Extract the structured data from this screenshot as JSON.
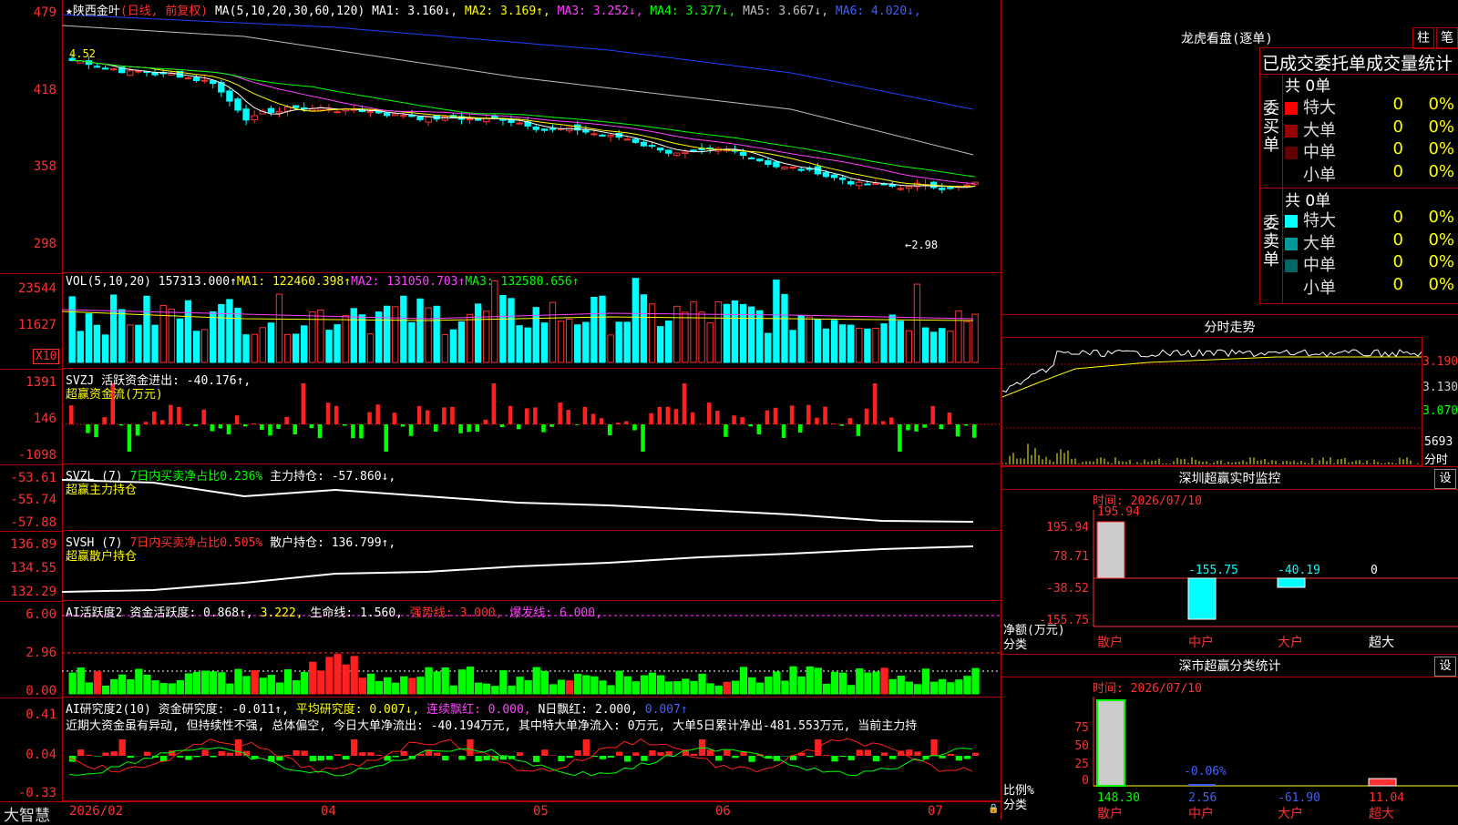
{
  "main": {
    "stock_name": "★陕西金叶",
    "period": "(日线, 前复权)",
    "ma_header": "MA(5,10,20,30,60,120)",
    "ma": [
      {
        "label": "MA1:",
        "value": "3.160↓",
        "color": "#ffffff"
      },
      {
        "label": "MA2:",
        "value": "3.169↑",
        "color": "#ffff00"
      },
      {
        "label": "MA3:",
        "value": "3.252↓",
        "color": "#ff40ff"
      },
      {
        "label": "MA4:",
        "value": "3.377↓",
        "color": "#00ff00"
      },
      {
        "label": "MA5:",
        "value": "3.667↓",
        "color": "#c0c0c0"
      },
      {
        "label": "MA6:",
        "value": "4.020↓",
        "color": "#4060ff"
      }
    ],
    "y_ticks": [
      "479",
      "418",
      "358",
      "298"
    ],
    "high_label": "4.52",
    "low_label": "←2.98"
  },
  "vol": {
    "header": "VOL(5,10,20)",
    "value": "157313.000↑",
    "ma1": "MA1: 122460.398↑",
    "ma2": "MA2: 131050.703↑",
    "ma3": "MA3: 132580.656↑",
    "y_ticks": [
      "23544",
      "11627"
    ],
    "unit": "X10"
  },
  "svzj": {
    "header": "SVZJ  活跃资金进出: -40.176↑,",
    "subtitle": "超赢资金流(万元)",
    "y_ticks": [
      "1391",
      "146",
      "-1098"
    ]
  },
  "svzl": {
    "header": "SVZL (7)",
    "ratio": "7日内买卖净占比0.236%",
    "hold": "主力持仓: -57.860↓,",
    "subtitle": "超赢主力持仓",
    "y_ticks": [
      "-53.61",
      "-55.74",
      "-57.88"
    ]
  },
  "svsh": {
    "header": "SVSH (7)",
    "ratio": "7日内买卖净占比0.505%",
    "hold": "散户持仓: 136.799↑,",
    "subtitle": "超赢散户持仓",
    "y_ticks": [
      "136.89",
      "134.55",
      "132.29"
    ]
  },
  "ai1": {
    "header": "AI活跃度2",
    "a": "资金活跃度: 0.868↑,",
    "b": "3.222,",
    "c": "生命线: 1.560,",
    "d": "强势线: 3.000,",
    "e": "爆发线: 6.000,",
    "y_ticks": [
      "6.00",
      "2.96",
      "0.00"
    ]
  },
  "ai2": {
    "header": "AI研究度2(10)",
    "a": "资金研究度: -0.011↑,",
    "b": "平均研究度: 0.007↓,",
    "c": "连续飘红: 0.000,",
    "d": "N日飘红: 2.000,",
    "e": "0.007↑",
    "text": "近期大资金虽有异动, 但持续性不强, 总体偏空, 今日大单净流出: -40.194万元, 其中特大单净流入: 0万元, 大单5日累计净出-481.553万元, 当前主力持",
    "y_ticks": [
      "0.41",
      "0.04",
      "-0.33"
    ]
  },
  "xaxis": {
    "brand": "大智慧",
    "labels": [
      "2026/02",
      "04",
      "05",
      "06",
      "07"
    ]
  },
  "right": {
    "dragon_title": "龙虎看盘(逐单)",
    "btn1": "柱",
    "btn2": "笔",
    "stats_title": "已成交委托单成交量统计",
    "buy_label": "委买单",
    "sell_label": "委卖单",
    "buy_total": "共 0单",
    "sell_total": "共 0单",
    "buy_rows": [
      {
        "name": "特大",
        "v": "0",
        "p": "0%",
        "color": "#ff0000"
      },
      {
        "name": "大单",
        "v": "0",
        "p": "0%",
        "color": "#990000"
      },
      {
        "name": "中单",
        "v": "0",
        "p": "0%",
        "color": "#660000"
      },
      {
        "name": "小单",
        "v": "0",
        "p": "0%",
        "color": "#000000"
      }
    ],
    "sell_rows": [
      {
        "name": "特大",
        "v": "0",
        "p": "0%",
        "color": "#00ffff"
      },
      {
        "name": "大单",
        "v": "0",
        "p": "0%",
        "color": "#009999"
      },
      {
        "name": "中单",
        "v": "0",
        "p": "0%",
        "color": "#006666"
      },
      {
        "name": "小单",
        "v": "0",
        "p": "0%",
        "color": "#000000"
      }
    ],
    "minute_title": "分时走势",
    "minute_ticks": [
      "3.190",
      "3.130",
      "3.070"
    ],
    "minute_vol": "5693",
    "minute_tag": "分时",
    "sz_title": "深圳超赢实时监控",
    "sz_set": "设",
    "sz_time": "时间: 2026/07/10",
    "sz_ticks": [
      "195.94",
      "78.71",
      "-38.52",
      "-155.75"
    ],
    "sz_values": [
      "195.94",
      "-155.75",
      "-40.19",
      "0"
    ],
    "sz_unit": "净额(万元)",
    "sz_cat_label": "分类",
    "sz_cats": [
      "散户",
      "中户",
      "大户",
      "超大"
    ],
    "cls_title": "深市超赢分类统计",
    "cls_set": "设",
    "cls_time": "时间: 2026/07/10",
    "cls_ticks": [
      "75",
      "50",
      "25",
      "0"
    ],
    "cls_values": [
      "148.30",
      "2.56",
      "-61.90",
      "11.04"
    ],
    "cls_mid_label": "-0.06%",
    "cls_unit": "比例%",
    "cls_cat_label": "分类",
    "cls_cats": [
      "散户",
      "中户",
      "大户",
      "超大"
    ]
  }
}
